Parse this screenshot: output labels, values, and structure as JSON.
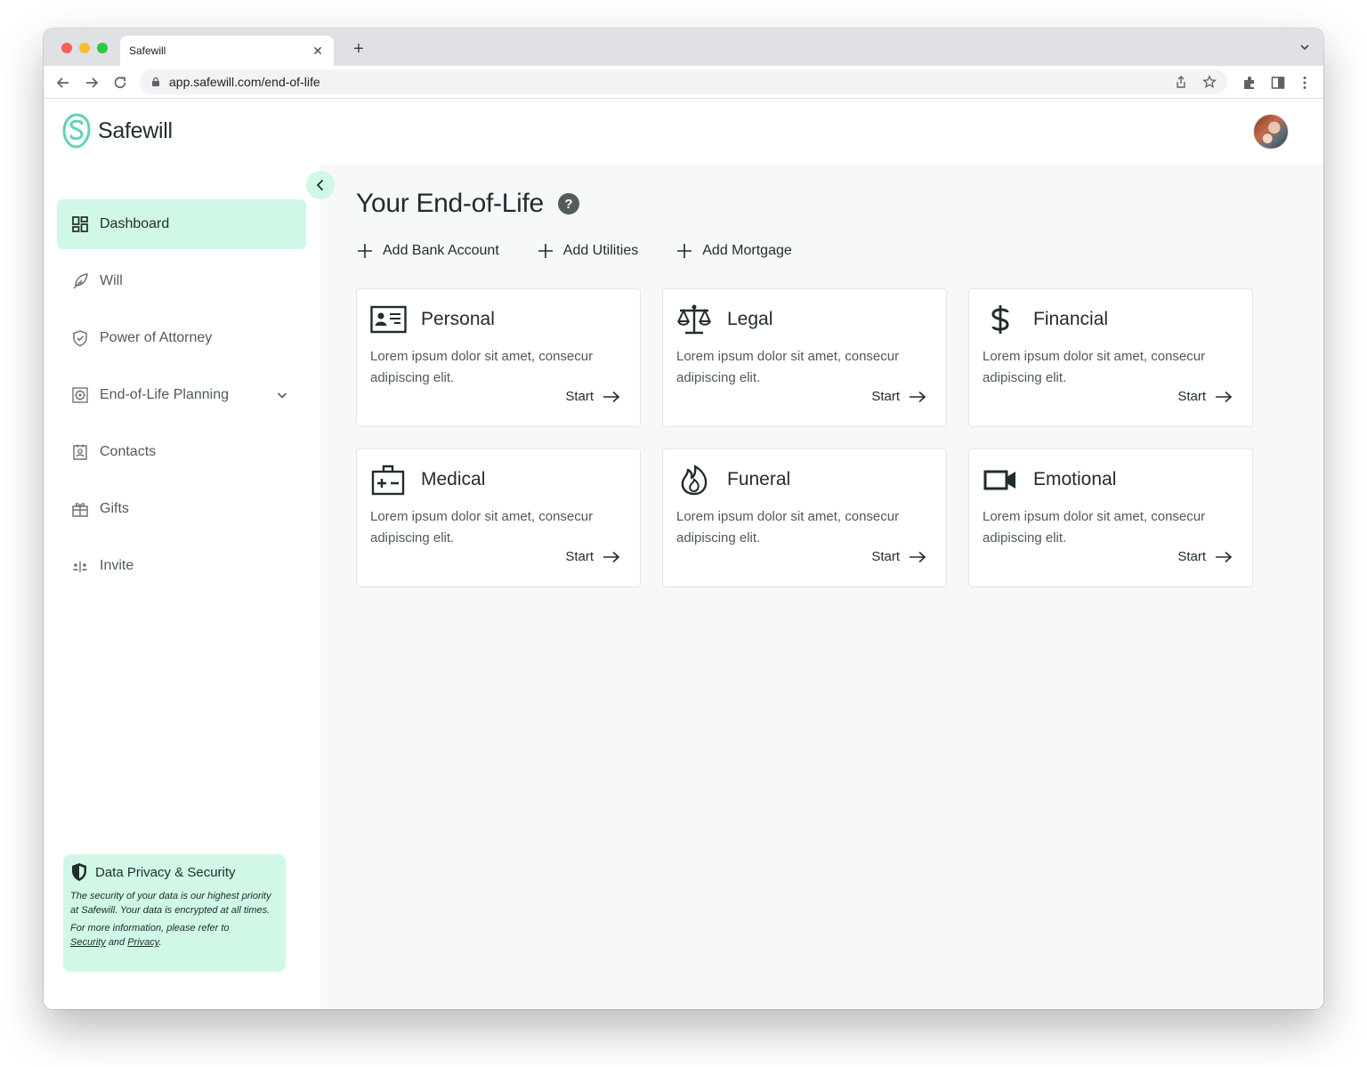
{
  "browser": {
    "tab_title": "Safewill",
    "url": "app.safewill.com/end-of-life",
    "traffic_lights": [
      "#ff5f57",
      "#febc2e",
      "#28c840"
    ]
  },
  "app": {
    "brand": "Safewill",
    "accent": "#d1f7e6",
    "brand_color": "#5fd3b4"
  },
  "sidebar": {
    "items": [
      {
        "label": "Dashboard",
        "icon": "dashboard-icon",
        "active": true
      },
      {
        "label": "Will",
        "icon": "feather-icon"
      },
      {
        "label": "Power of Attorney",
        "icon": "shield-check-icon"
      },
      {
        "label": "End-of-Life Planning",
        "icon": "settings-square-icon",
        "expandable": true
      },
      {
        "label": "Contacts",
        "icon": "contact-book-icon"
      },
      {
        "label": "Gifts",
        "icon": "gift-icon"
      },
      {
        "label": "Invite",
        "icon": "invite-people-icon"
      }
    ],
    "privacy": {
      "title": "Data Privacy & Security",
      "text1": "The security of your data is our highest priority at Safewill. Your data is encrypted at all times.",
      "text2_prefix": "For more information, please refer to",
      "security_link": "Security",
      "and": "and",
      "privacy_link": "Privacy",
      "period": "."
    }
  },
  "main": {
    "title": "Your End-of-Life",
    "help": "?",
    "actions": [
      {
        "label": "Add Bank Account"
      },
      {
        "label": "Add Utilities"
      },
      {
        "label": "Add Mortgage"
      }
    ],
    "cards": [
      {
        "title": "Personal",
        "icon": "id-card-icon",
        "desc": "Lorem ipsum dolor sit amet, consecur adipiscing elit.",
        "cta": "Start"
      },
      {
        "title": "Legal",
        "icon": "scales-icon",
        "desc": "Lorem ipsum dolor sit amet, consecur adipiscing elit.",
        "cta": "Start"
      },
      {
        "title": "Financial",
        "icon": "dollar-icon",
        "desc": "Lorem ipsum dolor sit amet, consecur adipiscing elit.",
        "cta": "Start"
      },
      {
        "title": "Medical",
        "icon": "medical-kit-icon",
        "desc": "Lorem ipsum dolor sit amet, consecur adipiscing elit.",
        "cta": "Start"
      },
      {
        "title": "Funeral",
        "icon": "flame-icon",
        "desc": "Lorem ipsum dolor sit amet, consecur adipiscing elit.",
        "cta": "Start"
      },
      {
        "title": "Emotional",
        "icon": "video-camera-icon",
        "desc": "Lorem ipsum dolor sit amet, consecur adipiscing elit.",
        "cta": "Start"
      }
    ]
  }
}
